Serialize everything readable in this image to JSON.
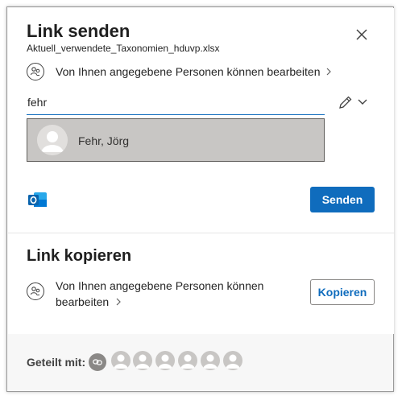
{
  "dialog": {
    "title": "Link senden",
    "filename": "Aktuell_verwendete_Taxonomien_hduvp.xlsx",
    "permission_text": "Von Ihnen angegebene Personen können bearbeiten"
  },
  "recipient": {
    "value": "fehr",
    "suggestion_name": "Fehr, Jörg"
  },
  "send_label": "Senden",
  "copy_section": {
    "title": "Link kopieren",
    "permission_line1": "Von Ihnen angegebene Personen können",
    "permission_line2": "bearbeiten",
    "copy_label": "Kopieren"
  },
  "shared": {
    "label": "Geteilt mit:"
  },
  "colors": {
    "accent": "#0f6cbd",
    "suggestion_bg": "#c8c6c4",
    "outlook_blue": "#0a64ad"
  }
}
